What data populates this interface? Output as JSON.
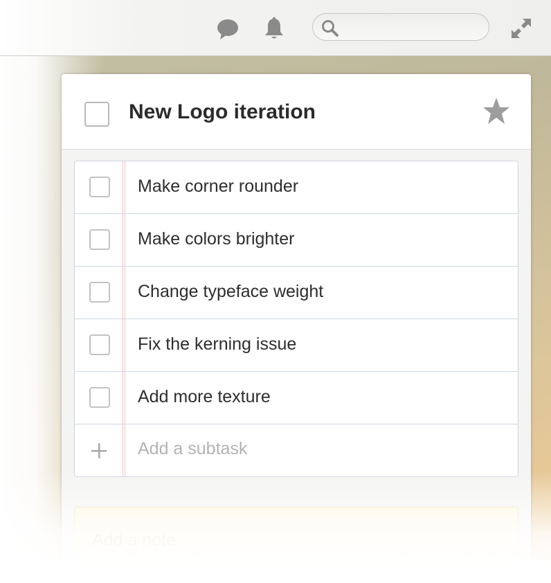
{
  "toolbar": {
    "icons": [
      "chat-bubble-icon",
      "bell-icon",
      "search-icon",
      "expand-icon"
    ],
    "search": {
      "value": "",
      "placeholder": ""
    }
  },
  "task": {
    "title": "New Logo iteration",
    "completed": false,
    "starred": false
  },
  "subtasks": [
    {
      "label": "Make corner rounder",
      "completed": false
    },
    {
      "label": "Make colors brighter",
      "completed": false
    },
    {
      "label": "Change typeface weight",
      "completed": false
    },
    {
      "label": "Fix the kerning issue",
      "completed": false
    },
    {
      "label": "Add more texture",
      "completed": false
    }
  ],
  "add_subtask": {
    "placeholder": "Add a subtask"
  },
  "note": {
    "placeholder": "Add a note"
  },
  "colors": {
    "accent_margin_line": "#f0c2c4",
    "row_divider": "#ccd8e2",
    "note_background": "#fdf6dc",
    "icon_gray": "#8a8a8a"
  }
}
